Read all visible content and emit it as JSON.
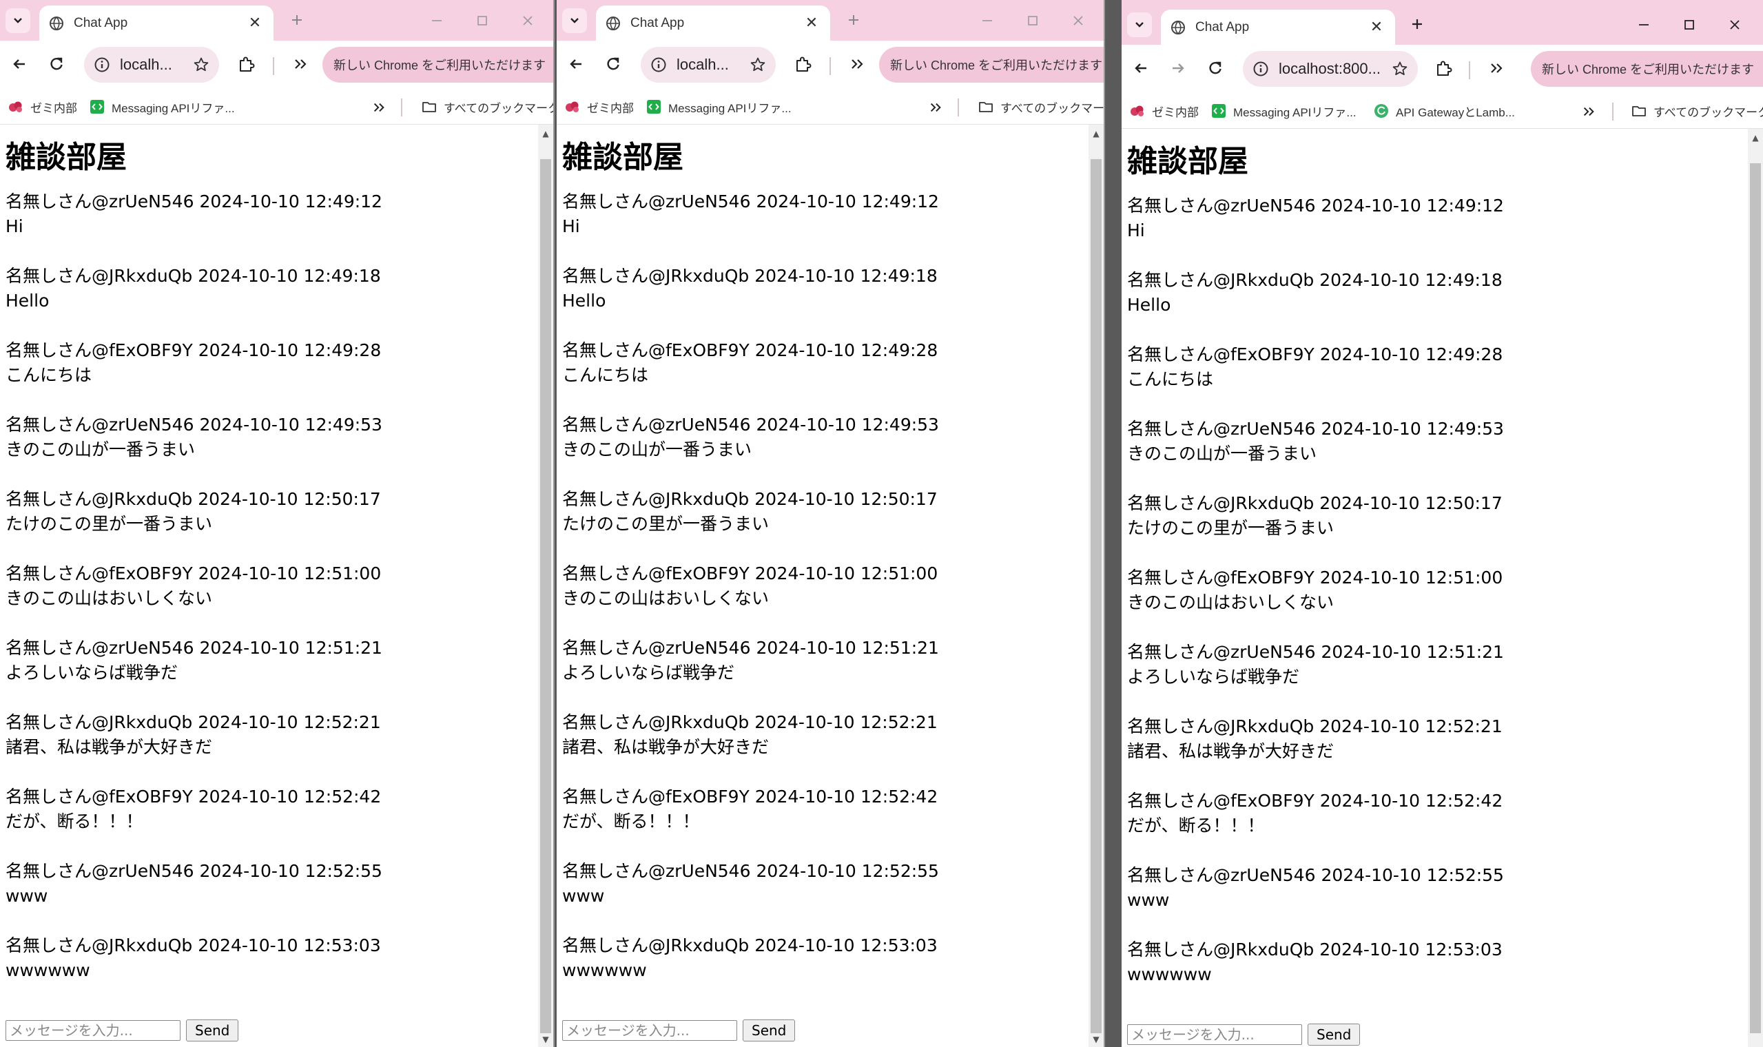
{
  "tab": {
    "title": "Chat App"
  },
  "address": {
    "url_short": "localh...",
    "url_wide": "localhost:800..."
  },
  "promo": {
    "label": "新しい Chrome をご利用いただけます"
  },
  "bookmarks": {
    "items": [
      "ゼミ内部",
      "Messaging APIリファ...",
      "API GatewayとLamb..."
    ],
    "all": "すべてのブックマーク"
  },
  "page": {
    "heading": "雑談部屋"
  },
  "messages": [
    {
      "meta": "名無しさん@zrUeN546 2024-10-10 12:49:12",
      "text": "Hi"
    },
    {
      "meta": "名無しさん@JRkxduQb 2024-10-10 12:49:18",
      "text": "Hello"
    },
    {
      "meta": "名無しさん@fExOBF9Y 2024-10-10 12:49:28",
      "text": "こんにちは"
    },
    {
      "meta": "名無しさん@zrUeN546 2024-10-10 12:49:53",
      "text": "きのこの山が一番うまい"
    },
    {
      "meta": "名無しさん@JRkxduQb 2024-10-10 12:50:17",
      "text": "たけのこの里が一番うまい"
    },
    {
      "meta": "名無しさん@fExOBF9Y 2024-10-10 12:51:00",
      "text": "きのこの山はおいしくない"
    },
    {
      "meta": "名無しさん@zrUeN546 2024-10-10 12:51:21",
      "text": "よろしいならば戦争だ"
    },
    {
      "meta": "名無しさん@JRkxduQb 2024-10-10 12:52:21",
      "text": "諸君、私は戦争が大好きだ"
    },
    {
      "meta": "名無しさん@fExOBF9Y 2024-10-10 12:52:42",
      "text": "だが、断る！！！"
    },
    {
      "meta": "名無しさん@zrUeN546 2024-10-10 12:52:55",
      "text": "www"
    },
    {
      "meta": "名無しさん@JRkxduQb 2024-10-10 12:53:03",
      "text": "wwwwww"
    }
  ],
  "composer": {
    "placeholder": "メッセージを入力...",
    "send_label": "Send"
  },
  "colors": {
    "chrome_frame": "#f6d1e1",
    "promo_pill": "#f3c7da",
    "omnibox": "#f5e6ee"
  }
}
